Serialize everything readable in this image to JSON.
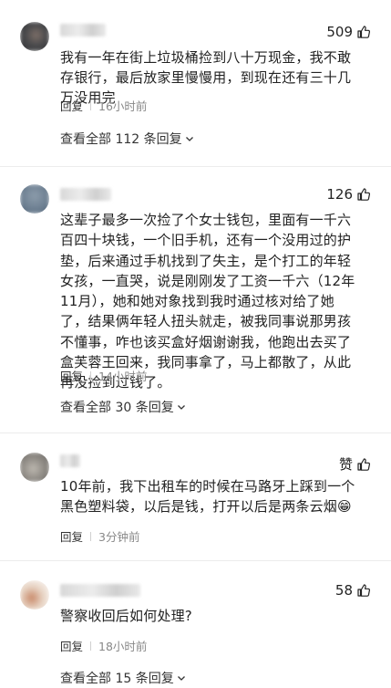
{
  "comments": [
    {
      "likes": "509",
      "text": "我有一年在街上垃圾桶捡到八十万现金，我不敢存银行，最后放家里慢慢用，到现在还有三十几万没用完",
      "reply_label": "回复",
      "time": "16小时前",
      "view_all": "查看全部 112 条回复"
    },
    {
      "likes": "126",
      "text": "这辈子最多一次捡了个女士钱包，里面有一千六百四十块钱，一个旧手机，还有一个没用过的护垫，后来通过手机找到了失主，是个打工的年轻女孩，一直哭，说是刚刚发了工资一千六（12年11月），她和她对象找到我时通过核对给了她了，结果俩年轻人扭头就走，被我同事说那男孩不懂事，咋也该买盒好烟谢谢我，他跑出去买了盒芙蓉王回来，我同事拿了，马上都散了，从此再没捡到过钱了。",
      "reply_label": "回复",
      "time": "14小时前",
      "view_all": "查看全部 30 条回复"
    },
    {
      "likes": "赞",
      "text": "10年前，我下出租车的时候在马路牙上踩到一个黑色塑料袋，以后是钱，打开以后是两条云烟😁",
      "reply_label": "回复",
      "time": "3分钟前"
    },
    {
      "likes": "58",
      "text": "警察收回后如何处理?",
      "reply_label": "回复",
      "time": "18小时前",
      "view_all": "查看全部 15 条回复"
    }
  ],
  "icons": {
    "like": "thumbs-up-icon",
    "expand": "chevron-down-icon"
  },
  "colors": {
    "text": "#222222",
    "meta": "#888888",
    "divider": "#ececec"
  }
}
